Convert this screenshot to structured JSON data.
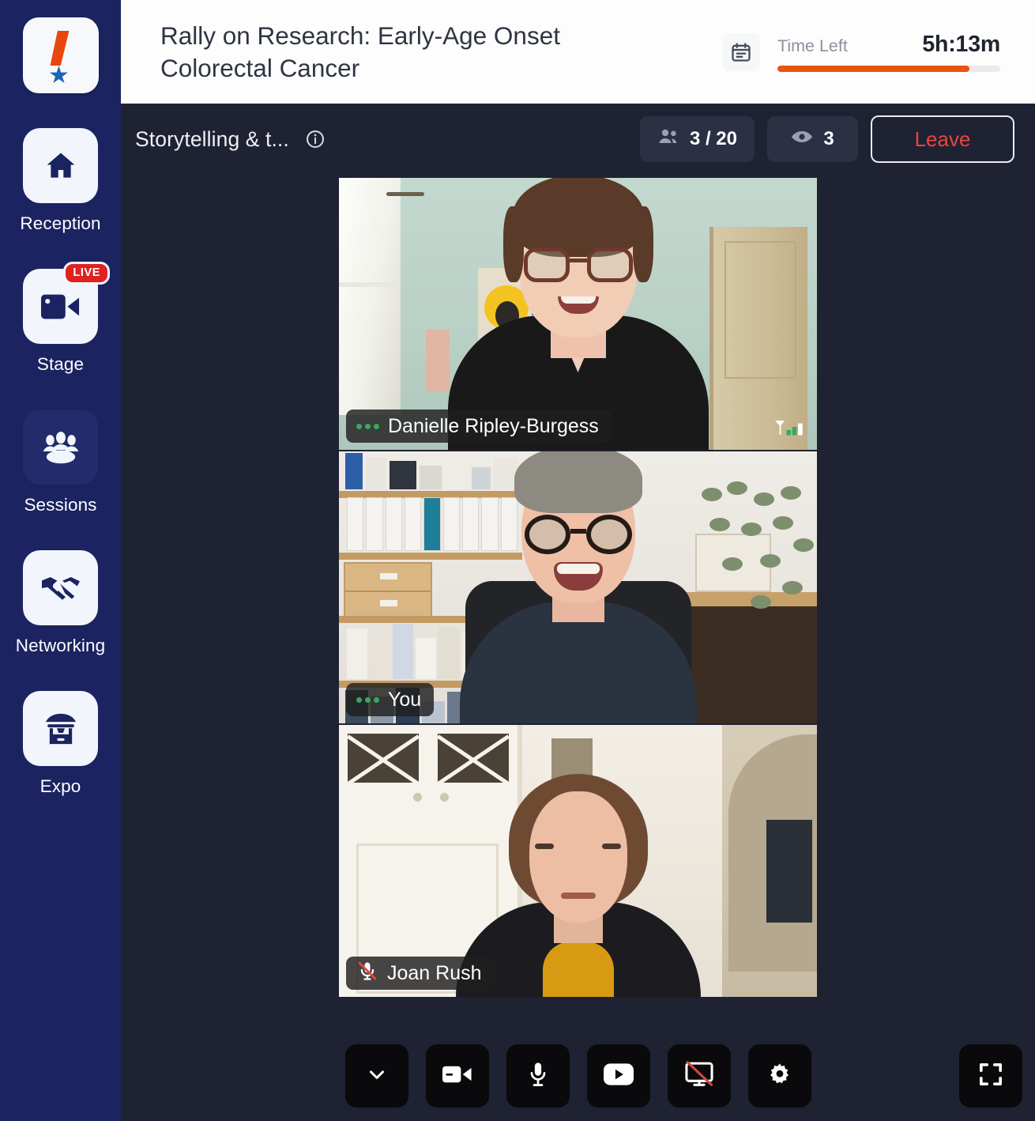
{
  "sidebar": {
    "brand_icon": "rally-exclamation-star-logo",
    "items": [
      {
        "label": "Reception",
        "icon": "home-icon",
        "active": false,
        "badge": null
      },
      {
        "label": "Stage",
        "icon": "video-camera-icon",
        "active": false,
        "badge": "LIVE"
      },
      {
        "label": "Sessions",
        "icon": "people-group-icon",
        "active": true,
        "badge": null
      },
      {
        "label": "Networking",
        "icon": "handshake-icon",
        "active": false,
        "badge": null
      },
      {
        "label": "Expo",
        "icon": "market-stall-icon",
        "active": false,
        "badge": null
      }
    ]
  },
  "header": {
    "event_title": "Rally on Research: Early-Age Onset Colorectal Cancer",
    "calendar_icon": "calendar-icon",
    "timer_label": "Time Left",
    "timer_value": "5h:13m",
    "timer_progress_percent": 86,
    "timer_fill_color": "#e8530f"
  },
  "session_bar": {
    "session_name": "Storytelling & t...",
    "info_icon": "info-circle-icon",
    "participants_icon": "people-icon",
    "participants_count": "3 / 20",
    "viewers_icon": "eye-icon",
    "viewers_count": "3",
    "leave_label": "Leave",
    "leave_color": "#e8453e"
  },
  "videos": [
    {
      "name": "Danielle Ripley-Burgess",
      "status_icon": "audio-active-dots",
      "muted": false,
      "signal_icon": "signal-strength-icon"
    },
    {
      "name": "You",
      "status_icon": "audio-active-dots",
      "muted": false,
      "signal_icon": null
    },
    {
      "name": "Joan Rush",
      "status_icon": "microphone-muted-icon",
      "muted": true,
      "signal_icon": null
    }
  ],
  "toolbar": {
    "buttons": [
      {
        "name": "chevron-down-icon",
        "label": "More options"
      },
      {
        "name": "video-camera-icon",
        "label": "Camera"
      },
      {
        "name": "microphone-icon",
        "label": "Microphone"
      },
      {
        "name": "play-video-icon",
        "label": "Play video"
      },
      {
        "name": "screen-share-off-icon",
        "label": "Stop screen share"
      },
      {
        "name": "gear-icon",
        "label": "Settings"
      }
    ],
    "fullscreen": {
      "name": "fullscreen-icon",
      "label": "Fullscreen"
    }
  }
}
